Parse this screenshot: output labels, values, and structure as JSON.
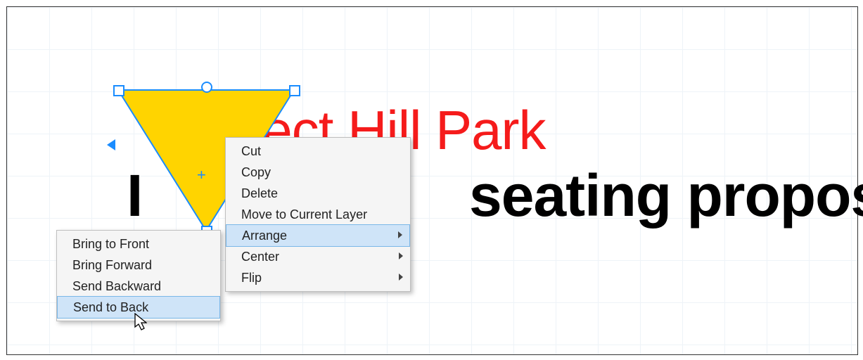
{
  "canvas": {
    "title_red": "pect Hill Park",
    "title_black_left": "I",
    "title_black_right": "seating proposal"
  },
  "shape": {
    "type": "triangle",
    "fill": "#ffd400",
    "stroke": "#1a8cff",
    "selected": true
  },
  "context_menu": {
    "items": [
      {
        "label": "Cut",
        "submenu": false,
        "highlighted": false
      },
      {
        "label": "Copy",
        "submenu": false,
        "highlighted": false
      },
      {
        "label": "Delete",
        "submenu": false,
        "highlighted": false
      },
      {
        "label": "Move to Current Layer",
        "submenu": false,
        "highlighted": false
      },
      {
        "label": "Arrange",
        "submenu": true,
        "highlighted": true
      },
      {
        "label": "Center",
        "submenu": true,
        "highlighted": false
      },
      {
        "label": "Flip",
        "submenu": true,
        "highlighted": false
      }
    ]
  },
  "submenu_arrange": {
    "items": [
      {
        "label": "Bring to Front",
        "highlighted": false
      },
      {
        "label": "Bring Forward",
        "highlighted": false
      },
      {
        "label": "Send Backward",
        "highlighted": false
      },
      {
        "label": "Send to Back",
        "highlighted": true
      }
    ]
  }
}
